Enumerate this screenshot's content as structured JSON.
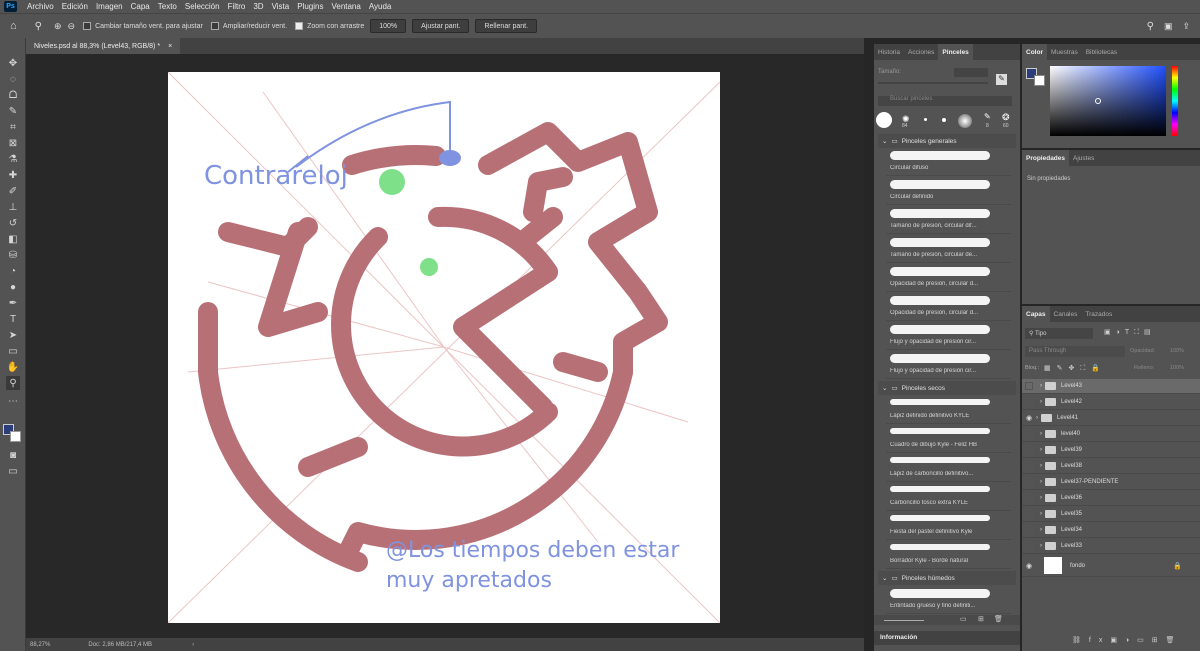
{
  "menubar": {
    "items": [
      "Archivo",
      "Edición",
      "Imagen",
      "Capa",
      "Texto",
      "Selección",
      "Filtro",
      "3D",
      "Vista",
      "Plugins",
      "Ventana",
      "Ayuda"
    ]
  },
  "options": {
    "resize_windows": "Cambiar tamaño vent. para ajustar",
    "zoom_all": "Ampliar/reducir vent.",
    "scrubby_zoom": "Zoom con arrastre",
    "zoom_value": "100%",
    "fit_screen": "Ajustar pant.",
    "fill_screen": "Rellenar pant."
  },
  "document": {
    "tab_title": "Niveles.psd al 88,3% (Level43, RGB/8) *",
    "zoom": "88,27%",
    "doc_info": "Doc: 2,86 MB/217,4 MB",
    "annotation_top": "Contrareloj",
    "annotation_bottom_1": "@Los tiempos deben estar",
    "annotation_bottom_2": "muy apretados"
  },
  "brushes_panel": {
    "tabs": [
      "Historia",
      "Acciones",
      "Pinceles"
    ],
    "size_label": "Tamaño:",
    "search_placeholder": "Buscar pinceles",
    "preset_sizes": [
      "84",
      "8",
      "60"
    ],
    "groups": [
      {
        "name": "Pinceles generales",
        "items": [
          "Circular difuso",
          "Circular definido",
          "Tamaño de presión, circular dif...",
          "Tamaño de presión, circular de...",
          "Opacidad de presión, circular d...",
          "Opacidad de presión, circular d...",
          "Flujo y opacidad de presión cir...",
          "Flujo y opacidad de presión cir..."
        ]
      },
      {
        "name": "Pinceles secos",
        "items": [
          "Lápiz definido definitivo KYLE",
          "Cuadro de dibujo Kyle - Feliz HB",
          "Lápiz de carboncillo definitivo...",
          "Carboncillo tosco extra KYLE",
          "Fiesta del pastel definitivo Kyle",
          "Borrador Kyle - Borde natural"
        ]
      },
      {
        "name": "Pinceles húmedos",
        "items": [
          "Entintado grueso y fino definiti..."
        ]
      }
    ]
  },
  "info_panel": {
    "title": "Información"
  },
  "color_panel": {
    "tabs": [
      "Color",
      "Muestras",
      "Bibliotecas"
    ],
    "fg_color": "#2b3d7a",
    "bg_color": "#ffffff"
  },
  "properties_panel": {
    "tabs": [
      "Propiedades",
      "Ajustes"
    ],
    "empty_text": "Sin propiedades"
  },
  "layers_panel": {
    "tabs": [
      "Capas",
      "Canales",
      "Trazados"
    ],
    "filter": "Tipo",
    "blend_mode": "Pass Through",
    "opacity_label": "Opacidad:",
    "opacity_value": "100%",
    "lock_label": "Bloq.:",
    "fill_label": "Relleno:",
    "fill_value": "100%",
    "layers": [
      "Level43",
      "Level42",
      "Level41",
      "level40",
      "Level39",
      "Level38",
      "Level37-PENDIENTE",
      "Level36",
      "Level35",
      "Level34",
      "Level33"
    ],
    "background": "fondo"
  },
  "colors": {
    "maze": "#b87077",
    "annotation": "#7f93e0",
    "green": "#7fe08a",
    "guide": "#e8b8b8"
  }
}
